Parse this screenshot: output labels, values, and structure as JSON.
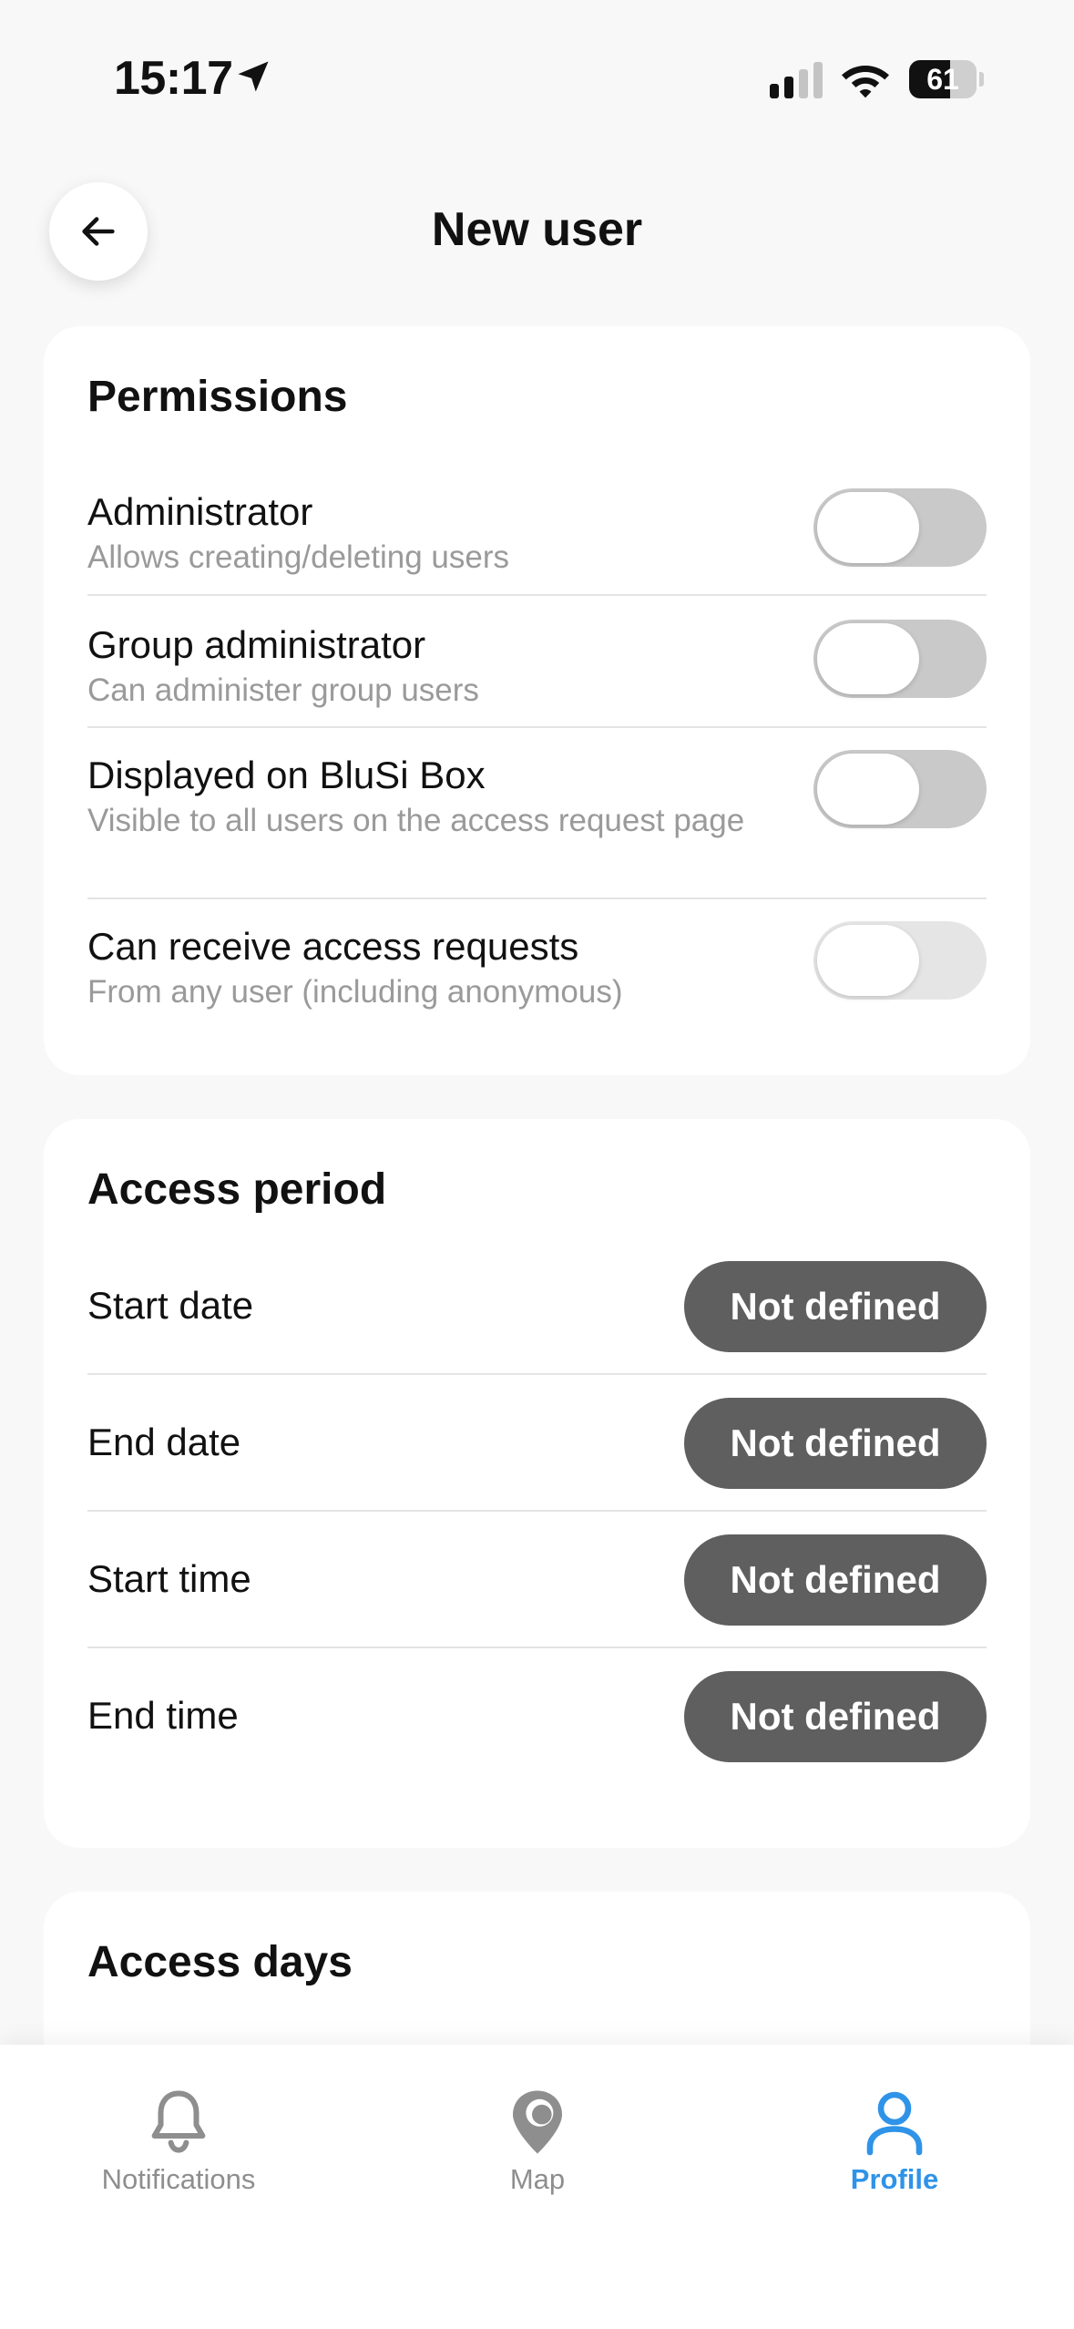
{
  "status_bar": {
    "time": "15:17",
    "battery_level": "61",
    "battery_fraction": 0.61
  },
  "header": {
    "title": "New user",
    "back_icon": "arrow-left-icon"
  },
  "permissions": {
    "title": "Permissions",
    "items": [
      {
        "title": "Administrator",
        "description": "Allows creating/deleting users",
        "enabled": false,
        "disabled": false
      },
      {
        "title": "Group administrator",
        "description": "Can administer group users",
        "enabled": false,
        "disabled": false
      },
      {
        "title": "Displayed on BluSi Box",
        "description": "Visible to all users on the access request page",
        "enabled": false,
        "disabled": false
      },
      {
        "title": "Can receive access requests",
        "description": "From any user (including anonymous)",
        "enabled": false,
        "disabled": true
      }
    ]
  },
  "access_period": {
    "title": "Access period",
    "rows": [
      {
        "label": "Start date",
        "value": "Not defined"
      },
      {
        "label": "End date",
        "value": "Not defined"
      },
      {
        "label": "Start time",
        "value": "Not defined"
      },
      {
        "label": "End time",
        "value": "Not defined"
      }
    ]
  },
  "access_days": {
    "title": "Access days"
  },
  "bottom_nav": {
    "items": [
      {
        "label": "Notifications",
        "icon": "bell-icon",
        "active": false
      },
      {
        "label": "Map",
        "icon": "map-pin-icon",
        "active": false
      },
      {
        "label": "Profile",
        "icon": "user-icon",
        "active": true
      }
    ]
  },
  "colors": {
    "accent": "#2f93e8",
    "pill": "#5f5f5f",
    "background": "#f8f8f8"
  }
}
